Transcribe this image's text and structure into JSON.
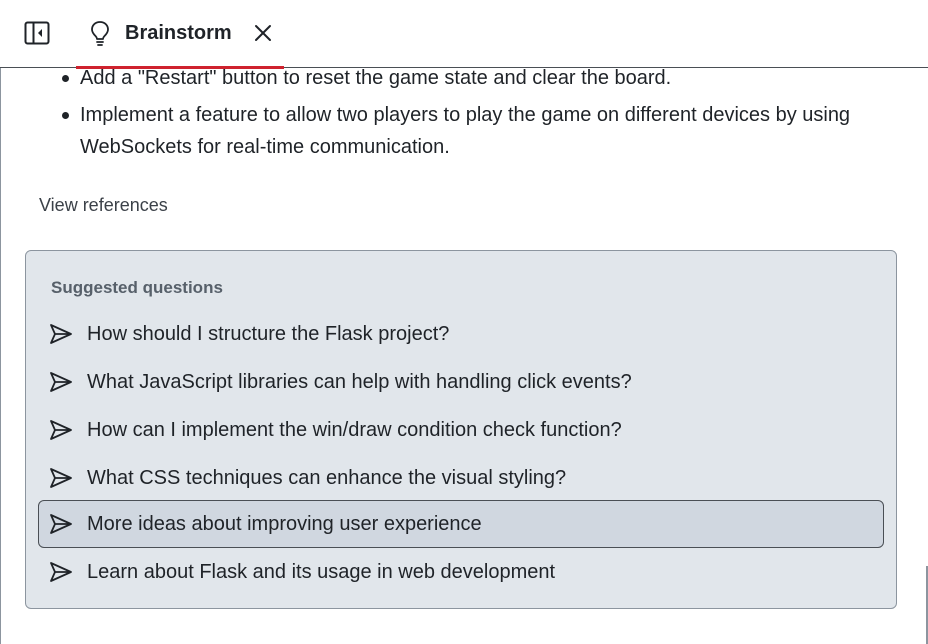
{
  "header": {
    "tab": {
      "label": "Brainstorm",
      "icon": "lightbulb-icon",
      "close_icon": "close-icon"
    },
    "sidebar_toggle_icon": "sidebar-collapse-icon",
    "accent_color": "#cf222e"
  },
  "content": {
    "bullets": [
      "Add a \"Restart\" button to reset the game state and clear the board.",
      "Implement a feature to allow two players to play the game on different devices by using WebSockets for real-time communication."
    ],
    "view_references": "View references"
  },
  "suggested": {
    "title": "Suggested questions",
    "icon": "send-icon",
    "questions": [
      "How should I structure the Flask project?",
      "What JavaScript libraries can help with handling click events?",
      "How can I implement the win/draw condition check function?",
      "What CSS techniques can enhance the visual styling?",
      "More ideas about improving user experience",
      "Learn about Flask and its usage in web development"
    ],
    "highlighted_index": 4
  }
}
